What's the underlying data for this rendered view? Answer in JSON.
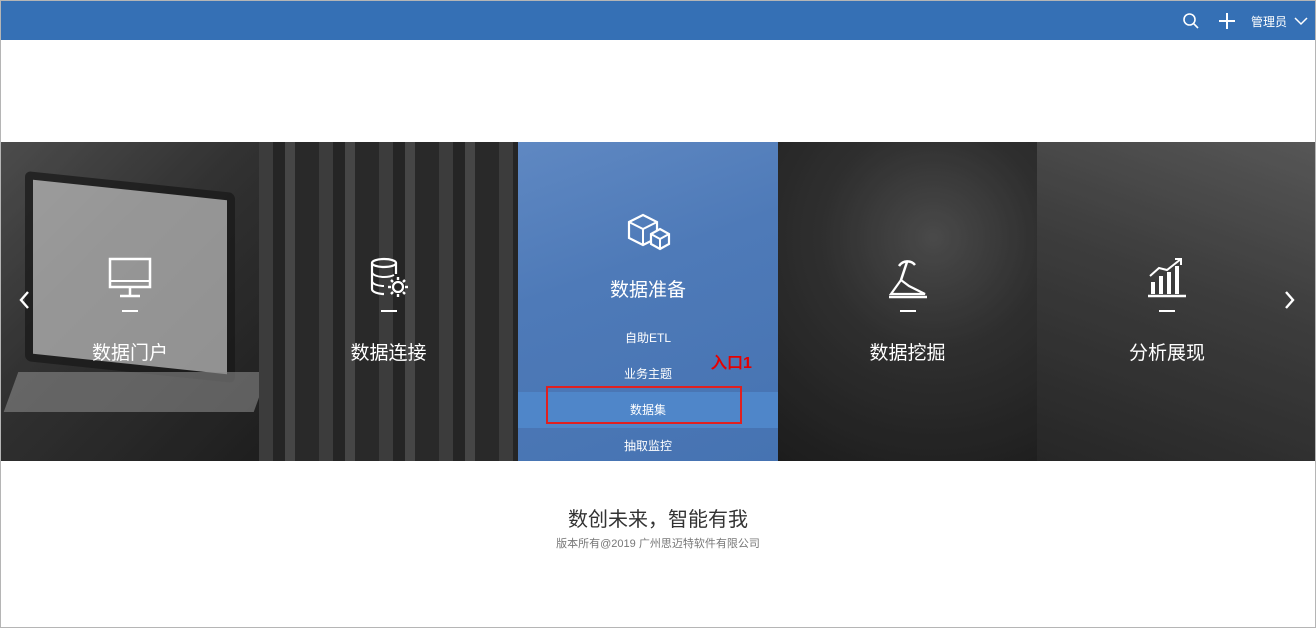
{
  "topbar": {
    "user_label": "管理员",
    "icons": [
      "search-icon",
      "plus-icon",
      "chevron-down-icon"
    ],
    "color": "#3570b5"
  },
  "panels": [
    {
      "title": "数据门户",
      "icon": "monitor-icon"
    },
    {
      "title": "数据连接",
      "icon": "database-gear-icon"
    },
    {
      "title": "数据准备",
      "icon": "cubes-icon",
      "menu": [
        "自助ETL",
        "业务主题",
        "数据集",
        "抽取监控"
      ],
      "active_item": "数据集",
      "color": "#4e7ab8"
    },
    {
      "title": "数据挖掘",
      "icon": "mining-icon"
    },
    {
      "title": "分析展现",
      "icon": "bar-chart-icon"
    }
  ],
  "annotation": {
    "label": "入口1",
    "color": "#e60000"
  },
  "footer": {
    "slogan": "数创未来，智能有我",
    "copyright": "版本所有@2019 广州思迈特软件有限公司"
  }
}
